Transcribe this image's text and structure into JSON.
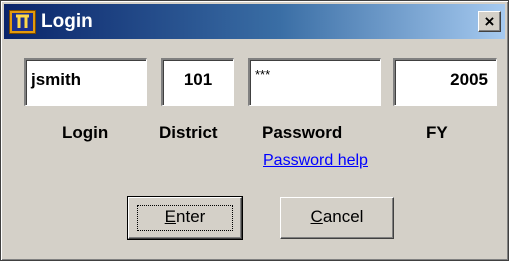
{
  "window": {
    "title": "Login",
    "close_glyph": "×"
  },
  "fields": {
    "login_value": "jsmith",
    "district_value": "101",
    "password_value": "***",
    "fy_value": "2005"
  },
  "labels": {
    "login": "Login",
    "district": "District",
    "password": "Password",
    "fy": "FY"
  },
  "help_link": "Password help",
  "buttons": {
    "enter_mnemonic": "E",
    "enter_rest": "nter",
    "cancel_mnemonic": "C",
    "cancel_rest": "ancel"
  },
  "icons": {
    "app": "app-logo-icon",
    "close": "close-icon"
  }
}
